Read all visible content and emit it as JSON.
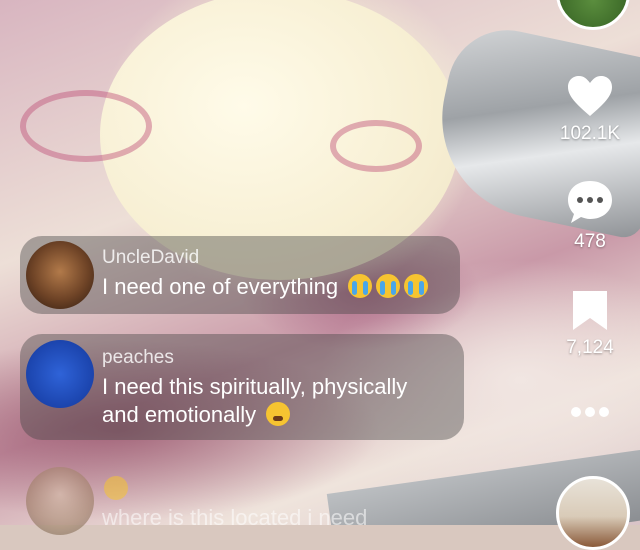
{
  "comments": [
    {
      "username": "UncleDavid",
      "text": "I need one of everything",
      "emoji": [
        "loudly-crying-face-icon",
        "loudly-crying-face-icon",
        "loudly-crying-face-icon"
      ]
    },
    {
      "username": "peaches",
      "text_line1": "I need this spiritually, physically",
      "text_line2": "and emotionally",
      "emoji": [
        "tired-face-icon"
      ]
    },
    {
      "username": "",
      "text": "where is this located i need",
      "emoji": [
        "nerd-face-icon"
      ]
    }
  ],
  "actions": {
    "likes": "102.1K",
    "comments": "478",
    "saves": "7,124",
    "more_icon": "more-dots-icon"
  }
}
